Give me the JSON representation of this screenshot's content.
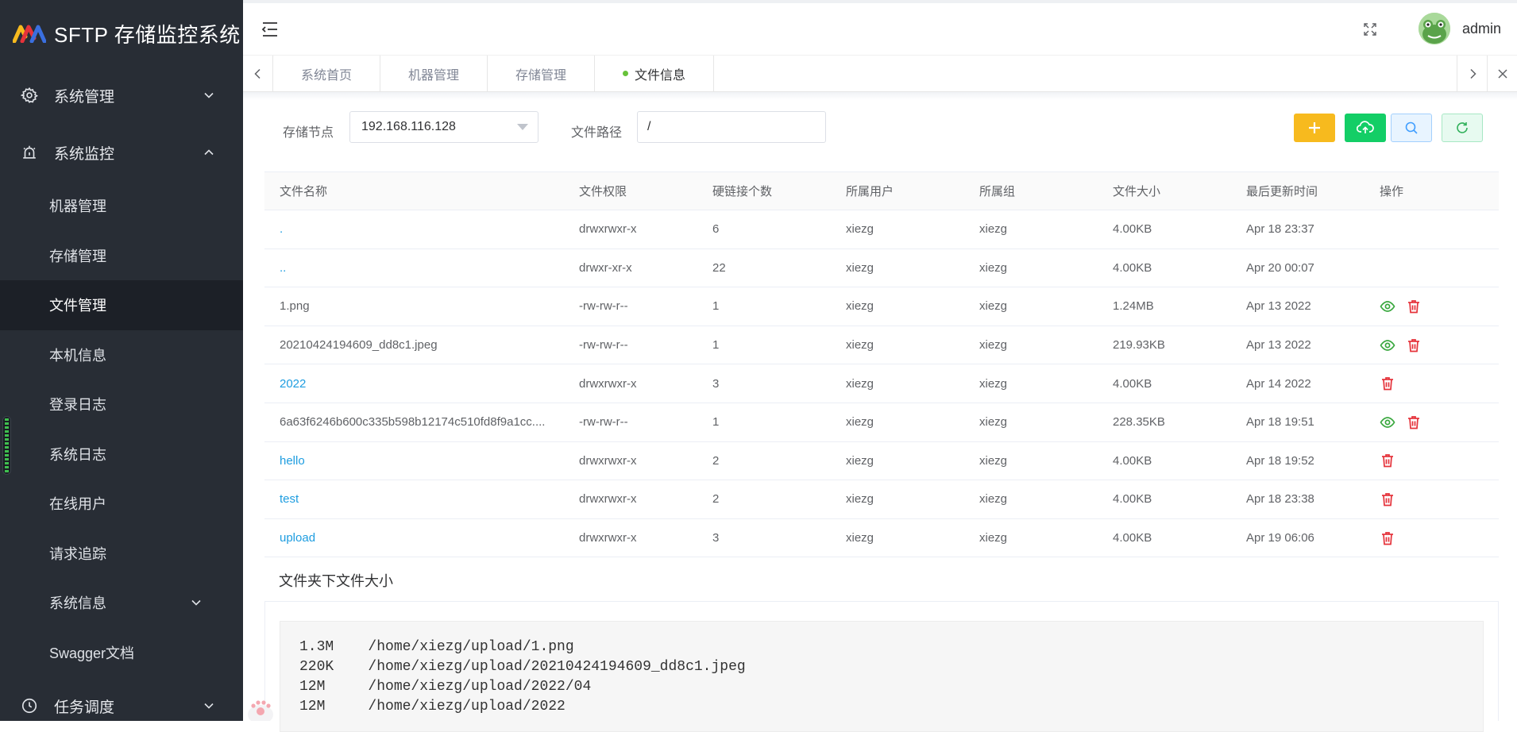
{
  "app": {
    "title": "SFTP 存储监控系统"
  },
  "sidebar": {
    "groups": [
      {
        "label": "系统管理",
        "icon": "gear-icon",
        "expanded": false
      },
      {
        "label": "系统监控",
        "icon": "alarm-icon",
        "expanded": true
      }
    ],
    "items": [
      {
        "label": "机器管理"
      },
      {
        "label": "存储管理"
      },
      {
        "label": "文件管理",
        "active": true
      },
      {
        "label": "本机信息"
      },
      {
        "label": "登录日志"
      },
      {
        "label": "系统日志"
      },
      {
        "label": "在线用户"
      },
      {
        "label": "请求追踪"
      },
      {
        "label": "系统信息",
        "has_children": true
      },
      {
        "label": "Swagger文档"
      }
    ],
    "bottom_group": {
      "label": "任务调度",
      "icon": "clock-icon"
    }
  },
  "header": {
    "username": "admin"
  },
  "tabs": [
    {
      "label": "系统首页"
    },
    {
      "label": "机器管理"
    },
    {
      "label": "存储管理"
    },
    {
      "label": "文件信息",
      "active": true
    }
  ],
  "filters": {
    "node_label": "存储节点",
    "node_value": "192.168.116.128",
    "path_label": "文件路径",
    "path_value": "/"
  },
  "table": {
    "headers": [
      "文件名称",
      "文件权限",
      "硬链接个数",
      "所属用户",
      "所属组",
      "文件大小",
      "最后更新时间",
      "操作"
    ],
    "rows": [
      {
        "name": ".",
        "perm": "drwxrwxr-x",
        "links": "6",
        "user": "xiezg",
        "group": "xiezg",
        "size": "4.00KB",
        "time": "Apr 18 23:37",
        "is_link": true,
        "actions": []
      },
      {
        "name": "..",
        "perm": "drwxr-xr-x",
        "links": "22",
        "user": "xiezg",
        "group": "xiezg",
        "size": "4.00KB",
        "time": "Apr 20 00:07",
        "is_link": true,
        "actions": []
      },
      {
        "name": "1.png",
        "perm": "-rw-rw-r--",
        "links": "1",
        "user": "xiezg",
        "group": "xiezg",
        "size": "1.24MB",
        "time": "Apr 13 2022",
        "is_link": false,
        "actions": [
          "view",
          "delete"
        ]
      },
      {
        "name": "20210424194609_dd8c1.jpeg",
        "perm": "-rw-rw-r--",
        "links": "1",
        "user": "xiezg",
        "group": "xiezg",
        "size": "219.93KB",
        "time": "Apr 13 2022",
        "is_link": false,
        "actions": [
          "view",
          "delete"
        ]
      },
      {
        "name": "2022",
        "perm": "drwxrwxr-x",
        "links": "3",
        "user": "xiezg",
        "group": "xiezg",
        "size": "4.00KB",
        "time": "Apr 14 2022",
        "is_link": true,
        "actions": [
          "delete"
        ]
      },
      {
        "name": "6a63f6246b600c335b598b12174c510fd8f9a1cc....",
        "perm": "-rw-rw-r--",
        "links": "1",
        "user": "xiezg",
        "group": "xiezg",
        "size": "228.35KB",
        "time": "Apr 18 19:51",
        "is_link": false,
        "actions": [
          "view",
          "delete"
        ]
      },
      {
        "name": "hello",
        "perm": "drwxrwxr-x",
        "links": "2",
        "user": "xiezg",
        "group": "xiezg",
        "size": "4.00KB",
        "time": "Apr 18 19:52",
        "is_link": true,
        "actions": [
          "delete"
        ]
      },
      {
        "name": "test",
        "perm": "drwxrwxr-x",
        "links": "2",
        "user": "xiezg",
        "group": "xiezg",
        "size": "4.00KB",
        "time": "Apr 18 23:38",
        "is_link": true,
        "actions": [
          "delete"
        ]
      },
      {
        "name": "upload",
        "perm": "drwxrwxr-x",
        "links": "3",
        "user": "xiezg",
        "group": "xiezg",
        "size": "4.00KB",
        "time": "Apr 19 06:06",
        "is_link": true,
        "actions": [
          "delete"
        ]
      }
    ]
  },
  "folder_size": {
    "title": "文件夹下文件大小",
    "lines": [
      "1.3M    /home/xiezg/upload/1.png",
      "220K    /home/xiezg/upload/20210424194609_dd8c1.jpeg",
      "12M     /home/xiezg/upload/2022/04",
      "12M     /home/xiezg/upload/2022"
    ]
  },
  "colors": {
    "sidebar_bg": "#282d35",
    "link": "#1e9de0",
    "view": "#3aa83f",
    "delete": "#e5323a",
    "add": "#f7ba1e",
    "upload": "#13ce66"
  }
}
